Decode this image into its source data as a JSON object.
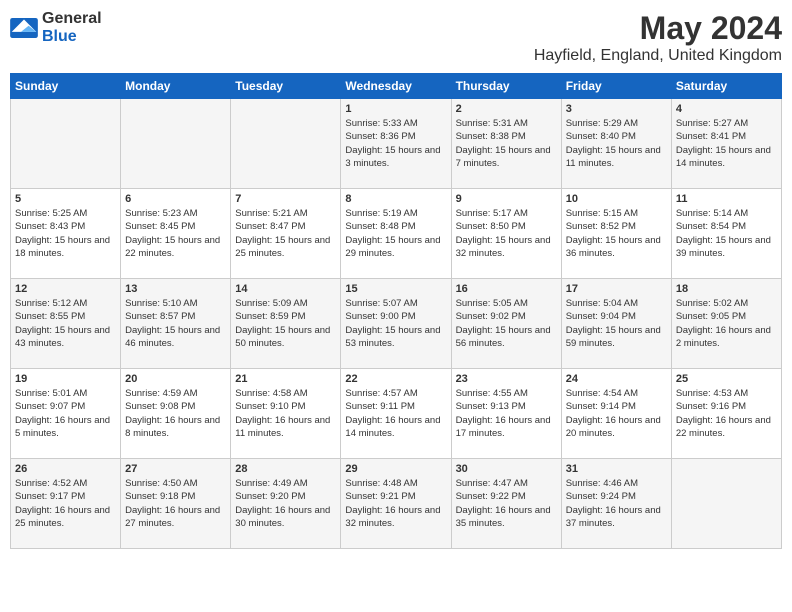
{
  "logo": {
    "general": "General",
    "blue": "Blue"
  },
  "title": "May 2024",
  "location": "Hayfield, England, United Kingdom",
  "days_of_week": [
    "Sunday",
    "Monday",
    "Tuesday",
    "Wednesday",
    "Thursday",
    "Friday",
    "Saturday"
  ],
  "weeks": [
    [
      {
        "day": "",
        "info": ""
      },
      {
        "day": "",
        "info": ""
      },
      {
        "day": "",
        "info": ""
      },
      {
        "day": "1",
        "info": "Sunrise: 5:33 AM\nSunset: 8:36 PM\nDaylight: 15 hours and 3 minutes."
      },
      {
        "day": "2",
        "info": "Sunrise: 5:31 AM\nSunset: 8:38 PM\nDaylight: 15 hours and 7 minutes."
      },
      {
        "day": "3",
        "info": "Sunrise: 5:29 AM\nSunset: 8:40 PM\nDaylight: 15 hours and 11 minutes."
      },
      {
        "day": "4",
        "info": "Sunrise: 5:27 AM\nSunset: 8:41 PM\nDaylight: 15 hours and 14 minutes."
      }
    ],
    [
      {
        "day": "5",
        "info": "Sunrise: 5:25 AM\nSunset: 8:43 PM\nDaylight: 15 hours and 18 minutes."
      },
      {
        "day": "6",
        "info": "Sunrise: 5:23 AM\nSunset: 8:45 PM\nDaylight: 15 hours and 22 minutes."
      },
      {
        "day": "7",
        "info": "Sunrise: 5:21 AM\nSunset: 8:47 PM\nDaylight: 15 hours and 25 minutes."
      },
      {
        "day": "8",
        "info": "Sunrise: 5:19 AM\nSunset: 8:48 PM\nDaylight: 15 hours and 29 minutes."
      },
      {
        "day": "9",
        "info": "Sunrise: 5:17 AM\nSunset: 8:50 PM\nDaylight: 15 hours and 32 minutes."
      },
      {
        "day": "10",
        "info": "Sunrise: 5:15 AM\nSunset: 8:52 PM\nDaylight: 15 hours and 36 minutes."
      },
      {
        "day": "11",
        "info": "Sunrise: 5:14 AM\nSunset: 8:54 PM\nDaylight: 15 hours and 39 minutes."
      }
    ],
    [
      {
        "day": "12",
        "info": "Sunrise: 5:12 AM\nSunset: 8:55 PM\nDaylight: 15 hours and 43 minutes."
      },
      {
        "day": "13",
        "info": "Sunrise: 5:10 AM\nSunset: 8:57 PM\nDaylight: 15 hours and 46 minutes."
      },
      {
        "day": "14",
        "info": "Sunrise: 5:09 AM\nSunset: 8:59 PM\nDaylight: 15 hours and 50 minutes."
      },
      {
        "day": "15",
        "info": "Sunrise: 5:07 AM\nSunset: 9:00 PM\nDaylight: 15 hours and 53 minutes."
      },
      {
        "day": "16",
        "info": "Sunrise: 5:05 AM\nSunset: 9:02 PM\nDaylight: 15 hours and 56 minutes."
      },
      {
        "day": "17",
        "info": "Sunrise: 5:04 AM\nSunset: 9:04 PM\nDaylight: 15 hours and 59 minutes."
      },
      {
        "day": "18",
        "info": "Sunrise: 5:02 AM\nSunset: 9:05 PM\nDaylight: 16 hours and 2 minutes."
      }
    ],
    [
      {
        "day": "19",
        "info": "Sunrise: 5:01 AM\nSunset: 9:07 PM\nDaylight: 16 hours and 5 minutes."
      },
      {
        "day": "20",
        "info": "Sunrise: 4:59 AM\nSunset: 9:08 PM\nDaylight: 16 hours and 8 minutes."
      },
      {
        "day": "21",
        "info": "Sunrise: 4:58 AM\nSunset: 9:10 PM\nDaylight: 16 hours and 11 minutes."
      },
      {
        "day": "22",
        "info": "Sunrise: 4:57 AM\nSunset: 9:11 PM\nDaylight: 16 hours and 14 minutes."
      },
      {
        "day": "23",
        "info": "Sunrise: 4:55 AM\nSunset: 9:13 PM\nDaylight: 16 hours and 17 minutes."
      },
      {
        "day": "24",
        "info": "Sunrise: 4:54 AM\nSunset: 9:14 PM\nDaylight: 16 hours and 20 minutes."
      },
      {
        "day": "25",
        "info": "Sunrise: 4:53 AM\nSunset: 9:16 PM\nDaylight: 16 hours and 22 minutes."
      }
    ],
    [
      {
        "day": "26",
        "info": "Sunrise: 4:52 AM\nSunset: 9:17 PM\nDaylight: 16 hours and 25 minutes."
      },
      {
        "day": "27",
        "info": "Sunrise: 4:50 AM\nSunset: 9:18 PM\nDaylight: 16 hours and 27 minutes."
      },
      {
        "day": "28",
        "info": "Sunrise: 4:49 AM\nSunset: 9:20 PM\nDaylight: 16 hours and 30 minutes."
      },
      {
        "day": "29",
        "info": "Sunrise: 4:48 AM\nSunset: 9:21 PM\nDaylight: 16 hours and 32 minutes."
      },
      {
        "day": "30",
        "info": "Sunrise: 4:47 AM\nSunset: 9:22 PM\nDaylight: 16 hours and 35 minutes."
      },
      {
        "day": "31",
        "info": "Sunrise: 4:46 AM\nSunset: 9:24 PM\nDaylight: 16 hours and 37 minutes."
      },
      {
        "day": "",
        "info": ""
      }
    ]
  ]
}
